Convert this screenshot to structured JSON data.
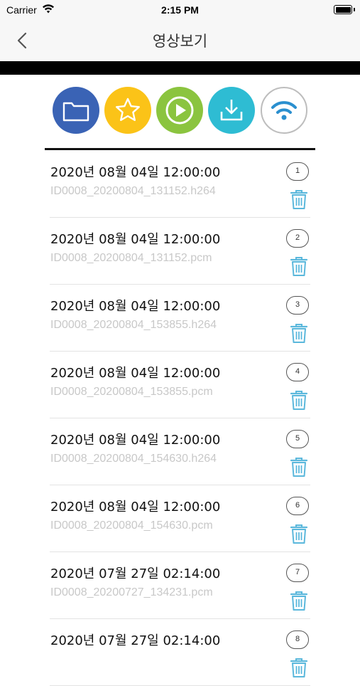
{
  "status_bar": {
    "carrier": "Carrier",
    "time": "2:15 PM"
  },
  "header": {
    "title": "영상보기",
    "back_icon": "chevron-left-icon"
  },
  "toolbar": {
    "buttons": [
      {
        "icon": "folder-icon",
        "color": "#3a63b5"
      },
      {
        "icon": "star-icon",
        "color": "#fbc318"
      },
      {
        "icon": "play-icon",
        "color": "#8bc43f"
      },
      {
        "icon": "download-icon",
        "color": "#2ebcd3"
      },
      {
        "icon": "wifi-icon",
        "color": "#ffffff"
      }
    ]
  },
  "files": [
    {
      "date": "2020년 08월 04일 12:00:00",
      "name": "ID0008_20200804_131152.h264",
      "index": "1"
    },
    {
      "date": "2020년 08월 04일 12:00:00",
      "name": "ID0008_20200804_131152.pcm",
      "index": "2"
    },
    {
      "date": "2020년 08월 04일 12:00:00",
      "name": "ID0008_20200804_153855.h264",
      "index": "3"
    },
    {
      "date": "2020년 08월 04일 12:00:00",
      "name": "ID0008_20200804_153855.pcm",
      "index": "4"
    },
    {
      "date": "2020년 08월 04일 12:00:00",
      "name": "ID0008_20200804_154630.h264",
      "index": "5"
    },
    {
      "date": "2020년 08월 04일 12:00:00",
      "name": "ID0008_20200804_154630.pcm",
      "index": "6"
    },
    {
      "date": "2020년 07월 27일 02:14:00",
      "name": "ID0008_20200727_134231.pcm",
      "index": "7"
    },
    {
      "date": "2020년 07월 27일 02:14:00",
      "name": "",
      "index": "8"
    }
  ]
}
